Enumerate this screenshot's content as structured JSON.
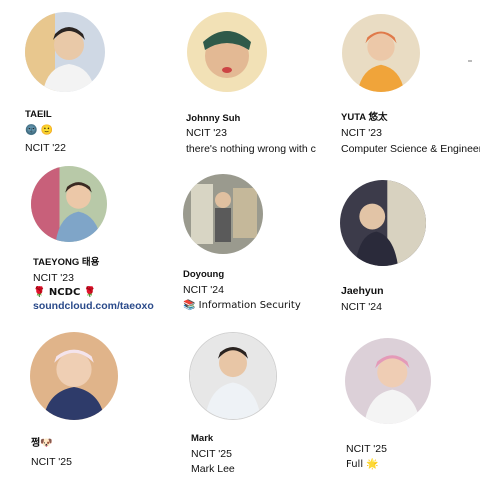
{
  "profiles": [
    {
      "name": "TAEIL",
      "badges": "🌚 🙂",
      "lines": [
        "NCIT '22"
      ]
    },
    {
      "name": "Johnny Suh",
      "lines": [
        "NCIT '23",
        "there's nothing wrong with c"
      ]
    },
    {
      "name": "YUTA 悠太",
      "lines": [
        "NCIT '23",
        "Computer Science & Engineer"
      ]
    },
    {
      "name": "TAEYONG 태용",
      "lines": [
        "NCIT '23",
        "🌹 NCDC 🌹"
      ],
      "link": "soundcloud.com/taeoxo"
    },
    {
      "name": "Doyoung",
      "lines": [
        "NCIT '24",
        "📚 Information Security"
      ]
    },
    {
      "name": "Jaehyun",
      "lines": [
        "NCIT '24"
      ]
    },
    {
      "name": "쩡🐶",
      "lines": [
        "NCIT '25"
      ]
    },
    {
      "name": "Mark",
      "lines": [
        "NCIT '25",
        "Mark Lee"
      ]
    },
    {
      "name": "",
      "lines": [
        "NCIT '25",
        "Full 🌟"
      ]
    }
  ],
  "colors": {
    "link": "#2a4a8a",
    "avatar_bgs": [
      "#cfd8e4",
      "#f2e1b6",
      "#e9dcc3",
      "#b8c9a8",
      "#9a9a8e",
      "#3c3b4a",
      "#e0b48a",
      "#e7e7e7",
      "#dcd0d8"
    ]
  }
}
